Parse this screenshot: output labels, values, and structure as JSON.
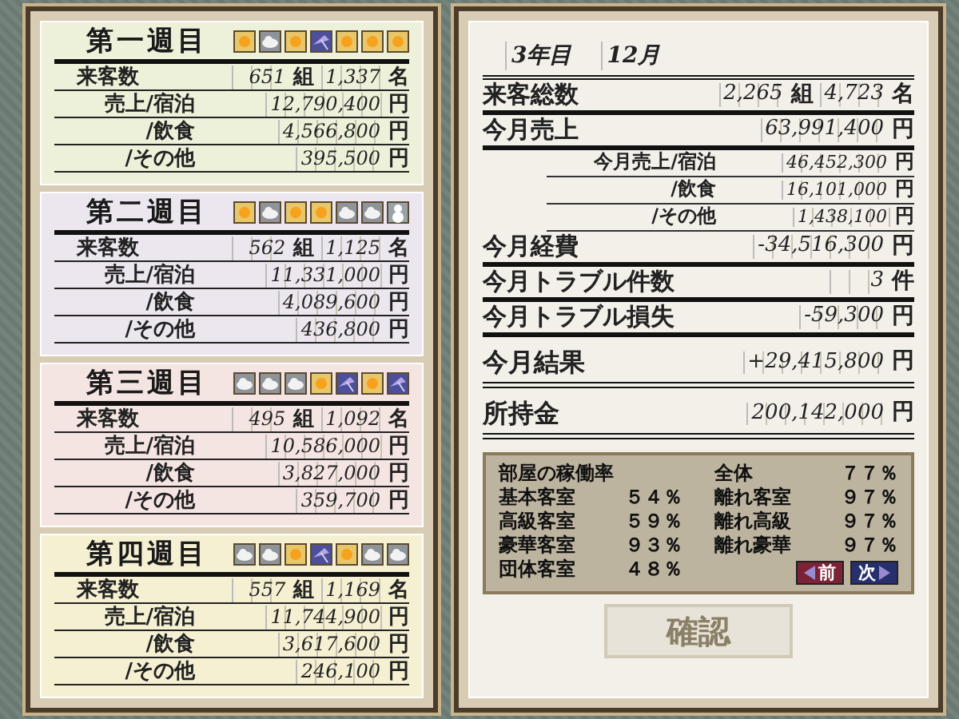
{
  "weeks": [
    {
      "title": "第一週目",
      "color": "#eef1d9",
      "weather": [
        {
          "kind": "sun"
        },
        {
          "kind": "cloud"
        },
        {
          "kind": "sun"
        },
        {
          "kind": "rain"
        },
        {
          "kind": "sun"
        },
        {
          "kind": "sun"
        },
        {
          "kind": "sun"
        }
      ],
      "rows": [
        {
          "label": "来客数",
          "cells": [
            {
              "value": "651",
              "unit": "組"
            },
            {
              "value": "1,337",
              "unit": "名"
            }
          ]
        },
        {
          "label": "売上/宿泊",
          "cells": [
            {
              "value": "12,790,400",
              "unit": "円"
            }
          ]
        },
        {
          "label": "/飲食",
          "cells": [
            {
              "value": "4,566,800",
              "unit": "円"
            }
          ]
        },
        {
          "label": "/その他",
          "cells": [
            {
              "value": "395,500",
              "unit": "円"
            }
          ]
        }
      ]
    },
    {
      "title": "第二週目",
      "color": "#ece6ef",
      "weather": [
        {
          "kind": "sun"
        },
        {
          "kind": "cloud"
        },
        {
          "kind": "sun"
        },
        {
          "kind": "sun"
        },
        {
          "kind": "cloud"
        },
        {
          "kind": "cloud"
        },
        {
          "kind": "snow"
        }
      ],
      "rows": [
        {
          "label": "来客数",
          "cells": [
            {
              "value": "562",
              "unit": "組"
            },
            {
              "value": "1,125",
              "unit": "名"
            }
          ]
        },
        {
          "label": "売上/宿泊",
          "cells": [
            {
              "value": "11,331,000",
              "unit": "円"
            }
          ]
        },
        {
          "label": "/飲食",
          "cells": [
            {
              "value": "4,089,600",
              "unit": "円"
            }
          ]
        },
        {
          "label": "/その他",
          "cells": [
            {
              "value": "436,800",
              "unit": "円"
            }
          ]
        }
      ]
    },
    {
      "title": "第三週目",
      "color": "#f5e5e2",
      "weather": [
        {
          "kind": "cloud"
        },
        {
          "kind": "cloud"
        },
        {
          "kind": "cloud"
        },
        {
          "kind": "sun"
        },
        {
          "kind": "rain"
        },
        {
          "kind": "sun"
        },
        {
          "kind": "rain"
        }
      ],
      "rows": [
        {
          "label": "来客数",
          "cells": [
            {
              "value": "495",
              "unit": "組"
            },
            {
              "value": "1,092",
              "unit": "名"
            }
          ]
        },
        {
          "label": "売上/宿泊",
          "cells": [
            {
              "value": "10,586,000",
              "unit": "円"
            }
          ]
        },
        {
          "label": "/飲食",
          "cells": [
            {
              "value": "3,827,000",
              "unit": "円"
            }
          ]
        },
        {
          "label": "/その他",
          "cells": [
            {
              "value": "359,700",
              "unit": "円"
            }
          ]
        }
      ]
    },
    {
      "title": "第四週目",
      "color": "#f6f0d2",
      "weather": [
        {
          "kind": "cloud"
        },
        {
          "kind": "cloud"
        },
        {
          "kind": "sun"
        },
        {
          "kind": "rain"
        },
        {
          "kind": "sun"
        },
        {
          "kind": "cloud"
        },
        {
          "kind": "cloud"
        }
      ],
      "rows": [
        {
          "label": "来客数",
          "cells": [
            {
              "value": "557",
              "unit": "組"
            },
            {
              "value": "1,169",
              "unit": "名"
            }
          ]
        },
        {
          "label": "売上/宿泊",
          "cells": [
            {
              "value": "11,744,900",
              "unit": "円"
            }
          ]
        },
        {
          "label": "/飲食",
          "cells": [
            {
              "value": "3,617,600",
              "unit": "円"
            }
          ]
        },
        {
          "label": "/その他",
          "cells": [
            {
              "value": "246,100",
              "unit": "円"
            }
          ]
        }
      ]
    }
  ],
  "month": {
    "year": "3年目",
    "month": "12月",
    "rows": [
      {
        "kind": "main",
        "label": "来客総数",
        "cells": [
          {
            "value": "2,265",
            "unit": "組"
          },
          {
            "value": "4,723",
            "unit": "名"
          }
        ]
      },
      {
        "kind": "main",
        "label": "今月売上",
        "cells": [
          {
            "value": "63,991,400",
            "unit": "円"
          }
        ]
      },
      {
        "kind": "sub",
        "label": "今月売上/宿泊",
        "cells": [
          {
            "value": "46,452,300",
            "unit": "円"
          }
        ]
      },
      {
        "kind": "sub",
        "label": "/飲食",
        "cells": [
          {
            "value": "16,101,000",
            "unit": "円"
          }
        ]
      },
      {
        "kind": "sub",
        "label": "/その他",
        "cells": [
          {
            "value": "1,438,100",
            "unit": "円"
          }
        ]
      },
      {
        "kind": "main",
        "label": "今月経費",
        "cells": [
          {
            "value": "-34,516,300",
            "unit": "円"
          }
        ]
      },
      {
        "kind": "main",
        "label": "今月トラブル件数",
        "cells": [
          {
            "value": "3",
            "unit": "件"
          }
        ]
      },
      {
        "kind": "main",
        "label": "今月トラブル損失",
        "cells": [
          {
            "value": "-59,300",
            "unit": "円"
          }
        ]
      },
      {
        "kind": "total",
        "label": "今月結果",
        "cells": [
          {
            "value": "+29,415,800",
            "unit": "円"
          }
        ]
      },
      {
        "kind": "total",
        "label": "所持金",
        "cells": [
          {
            "value": "200,142,000",
            "unit": "円"
          }
        ]
      }
    ]
  },
  "occupancy": {
    "title": "部屋の稼働率",
    "overall": {
      "label": "全体",
      "value": "７７％"
    },
    "left": [
      {
        "label": "基本客室",
        "value": "５４％"
      },
      {
        "label": "高級客室",
        "value": "５９％"
      },
      {
        "label": "豪華客室",
        "value": "９３％"
      },
      {
        "label": "団体客室",
        "value": "４８％"
      }
    ],
    "right": [
      {
        "label": "離れ客室",
        "value": "９７％"
      },
      {
        "label": "離れ高級",
        "value": "９７％"
      },
      {
        "label": "離れ豪華",
        "value": "９７％"
      }
    ],
    "prev": "前",
    "next": "次"
  },
  "confirm": {
    "label": "確認",
    "disabled": true
  }
}
